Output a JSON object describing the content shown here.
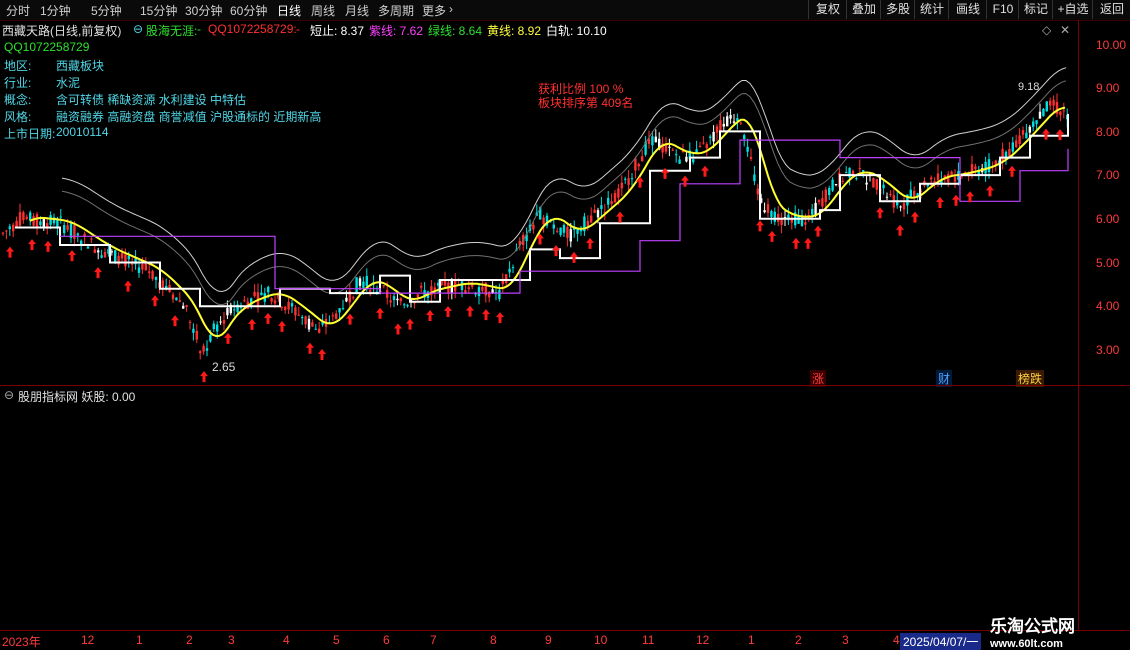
{
  "toolbar": {
    "periods": [
      "分时",
      "1分钟",
      "5分钟",
      "15分钟",
      "30分钟",
      "60分钟",
      "日线",
      "周线",
      "月线",
      "多周期",
      "更多"
    ],
    "active_period": "日线",
    "right_buttons": [
      "复权",
      "叠加",
      "多股",
      "统计",
      "画线",
      "F10",
      "标记",
      "+自选",
      "返回"
    ]
  },
  "info": {
    "stock_title": "西藏天路(日线,前复权)",
    "indicator_name": "股海无涯:",
    "indicator_value": "-",
    "qq_text": "QQ1072258729:",
    "qq_value": "-",
    "short_stop": "短止: 8.37",
    "purple_line": "紫线: 7.62",
    "green_line": "绿线: 8.64",
    "yellow_line": "黄线: 8.92",
    "white_rail": "白轨: 10.10"
  },
  "profile": {
    "qq": "QQ1072258729",
    "region_label": "地区:",
    "region_value": "西藏板块",
    "industry_label": "行业:",
    "industry_value": "水泥",
    "concept_label": "概念:",
    "concept_value": "含可转债 稀缺资源 水利建设 中特估",
    "style_label": "风格:",
    "style_value": "融资融券 高融资盘 商誉减值 沪股通标的 近期新高",
    "listing_label": "上市日期:",
    "listing_value": "20010114"
  },
  "annotations": {
    "profit_ratio": "获利比例 100 %",
    "sector_rank": "板块排序第 409名",
    "low_price": "2.65",
    "high_price": "9.18"
  },
  "y_axis": [
    "10.00",
    "9.00",
    "8.00",
    "7.00",
    "6.00",
    "5.00",
    "4.00",
    "3.00"
  ],
  "event_tags": [
    {
      "label": "涨",
      "color": "#ff3b3b"
    },
    {
      "label": "财",
      "color": "#4fa0ff"
    },
    {
      "label": "榜跌",
      "color": "#ffd040"
    }
  ],
  "sub_panel": {
    "title": "股朋指标网 妖股: 0.00"
  },
  "date_axis": [
    "2023年",
    "12",
    "1",
    "2",
    "3",
    "4",
    "5",
    "6",
    "7",
    "8",
    "9",
    "10",
    "11",
    "12",
    "1",
    "2",
    "3",
    "4",
    "2025/04/07/一"
  ],
  "watermark": {
    "brand": "乐淘公式网",
    "url": "www.60lt.com"
  },
  "colors": {
    "up": "#ff3030",
    "down": "#00e0e0",
    "yellow_line": "#ffff30",
    "white_line": "#ffffff",
    "purple_line": "#c040ff",
    "border": "#7a0000"
  }
}
